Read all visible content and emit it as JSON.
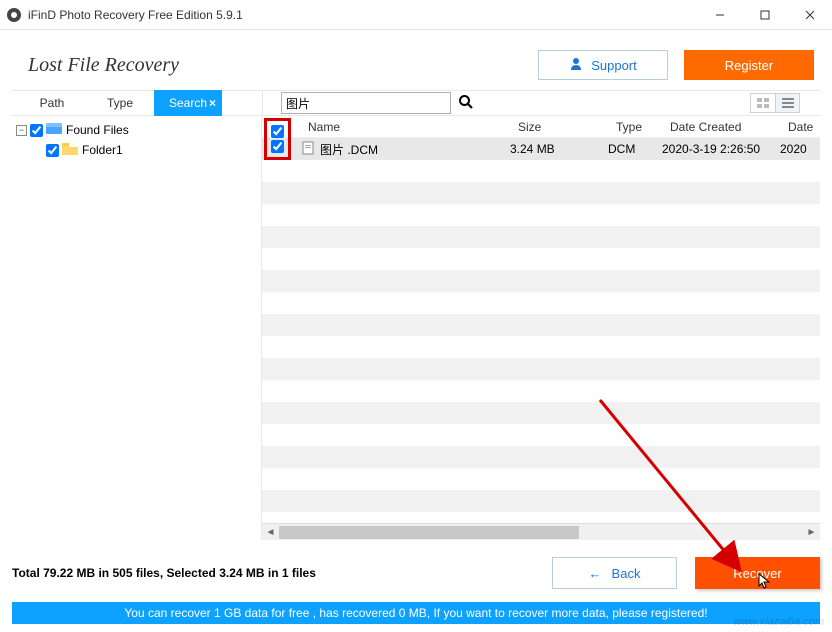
{
  "window": {
    "title": "iFinD Photo Recovery Free Edition 5.9.1"
  },
  "header": {
    "title": "Lost File Recovery",
    "support_label": "Support",
    "register_label": "Register"
  },
  "tabs": {
    "path": "Path",
    "type": "Type",
    "search": "Search"
  },
  "search": {
    "value": "图片"
  },
  "tree": {
    "root_label": "Found Files",
    "child_label": "Folder1"
  },
  "columns": {
    "name": "Name",
    "size": "Size",
    "type": "Type",
    "date_created": "Date Created",
    "date2": "Date"
  },
  "file": {
    "name": "图片 .DCM",
    "size": "3.24 MB",
    "type": "DCM",
    "date_created": "2020-3-19 2:26:50",
    "date2": "2020"
  },
  "footer": {
    "status": "Total 79.22 MB in 505 files,  Selected 3.24 MB in 1 files",
    "back_label": "Back",
    "recover_label": "Recover",
    "promo": "You can recover 1 GB data for free , has recovered 0 MB, If you want to recover more data, please registered!"
  },
  "watermark": "www.xiazaiba.com"
}
